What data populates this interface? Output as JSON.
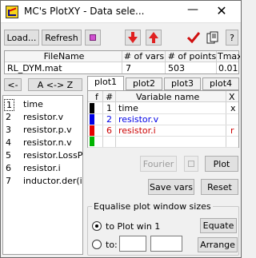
{
  "window": {
    "title": "MC's PlotXY - Data sele...",
    "minimize_glyph": "—",
    "close_glyph": "✕"
  },
  "toolbar": {
    "load_label": "Load...",
    "refresh_label": "Refresh",
    "help_label": "?",
    "icons": [
      "magenta-square-icon",
      "arrow-down-icon",
      "arrow-up-icon",
      "checkmark-icon",
      "copy-icon"
    ]
  },
  "file_table": {
    "headers": [
      "FileName",
      "# of vars",
      "# of points",
      "Tmax"
    ],
    "rows": [
      [
        "RL_DYM.mat",
        "7",
        "503",
        "0.01"
      ]
    ]
  },
  "list_controls": {
    "back_label": "<-",
    "sort_label": "A <-> Z"
  },
  "variables": [
    {
      "num": "1",
      "name": "time"
    },
    {
      "num": "2",
      "name": "resistor.v"
    },
    {
      "num": "3",
      "name": "resistor.p.v"
    },
    {
      "num": "4",
      "name": "resistor.n.v"
    },
    {
      "num": "5",
      "name": "resistor.LossPo"
    },
    {
      "num": "6",
      "name": "resistor.i"
    },
    {
      "num": "7",
      "name": "inductor.der(i)"
    }
  ],
  "tabs": [
    "plot1",
    "plot2",
    "plot3",
    "plot4"
  ],
  "plot_table": {
    "headers": [
      "f",
      "#",
      "Variable name",
      "X"
    ],
    "rows": [
      {
        "num": "1",
        "name": "time",
        "x": "x",
        "color": "#000000",
        "text_color": "#000000"
      },
      {
        "num": "2",
        "name": "resistor.v",
        "x": "",
        "color": "#0000e6",
        "text_color": "#0000e6"
      },
      {
        "num": "6",
        "name": "resistor.i",
        "x": "r",
        "color": "#e60000",
        "text_color": "#cc0000"
      },
      {
        "num": "",
        "name": "",
        "x": "",
        "color": "#00b400",
        "text_color": "#000000"
      }
    ]
  },
  "actions": {
    "fourier_label": "Fourier",
    "plot_label": "Plot",
    "save_vars_label": "Save vars",
    "reset_label": "Reset"
  },
  "equalise": {
    "group_label": "Equalise plot window sizes",
    "option1_label": "to Plot win 1",
    "option2_label": "to:",
    "equate_label": "Equate",
    "arrange_label": "Arrange",
    "width_value": "",
    "height_value": ""
  },
  "colors": {
    "red_arrow": "#e02020",
    "magenta": "#d050d0",
    "check_red": "#d01010"
  }
}
